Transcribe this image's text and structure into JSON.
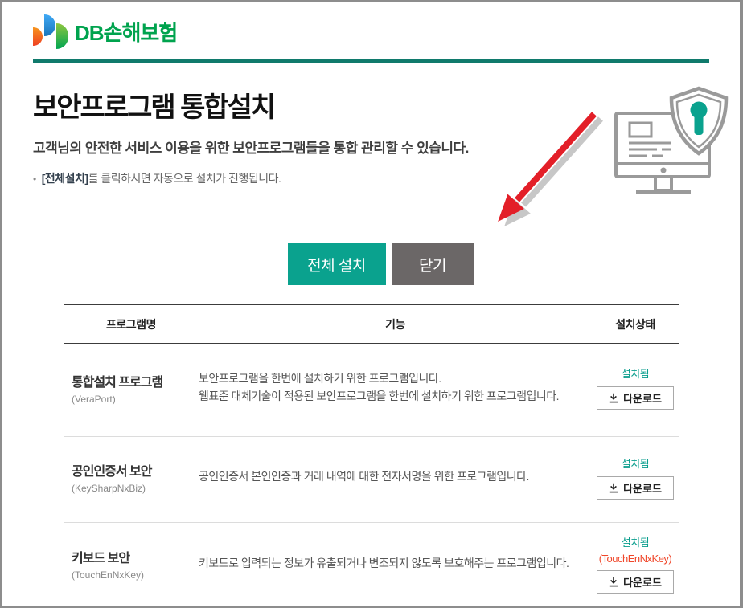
{
  "header": {
    "logo_text": "DB손해보험"
  },
  "page": {
    "title": "보안프로그램 통합설치",
    "subtitle": "고객님의 안전한 서비스 이용을 위한 보안프로그램들을 통합 관리할 수 있습니다.",
    "note_highlight": "[전체설치]",
    "note_rest": "를 클릭하시면 자동으로 설치가 진행됩니다."
  },
  "buttons": {
    "install_all": "전체 설치",
    "close": "닫기"
  },
  "table": {
    "headers": {
      "name": "프로그램명",
      "func": "기능",
      "status": "설치상태"
    },
    "rows": [
      {
        "name": "통합설치 프로그램",
        "code": "(VeraPort)",
        "desc1": "보안프로그램을 한번에 설치하기 위한 프로그램입니다.",
        "desc2": "웹표준 대체기술이 적용된 보안프로그램을 한번에 설치하기 위한 프로그램입니다.",
        "status": "설치됨",
        "download_label": "다운로드"
      },
      {
        "name": "공인인증서 보안",
        "code": "(KeySharpNxBiz)",
        "desc1": "공인인증서 본인인증과 거래 내역에 대한 전자서명을 위한 프로그램입니다.",
        "status": "설치됨",
        "download_label": "다운로드"
      },
      {
        "name": "키보드 보안",
        "code": "(TouchEnNxKey)",
        "desc1": "키보드로 입력되는 정보가 유출되거나 변조되지 않도록 보호해주는 프로그램입니다.",
        "status": "설치됨",
        "status_note": "(TouchEnNxKey)",
        "download_label": "다운로드"
      }
    ]
  },
  "icons": {
    "logo_mark": "db-tricolor-mark",
    "download": "download-icon",
    "pointer": "red-arrow-pointer",
    "illustration": "monitor-with-security-shield"
  },
  "colors": {
    "brand-green": "#00a34e",
    "divider-teal": "#107a6c",
    "accent-teal": "#0aa28e",
    "gray-button": "#6b6767",
    "status-teal": "#0a9e8d",
    "alert-red": "#f0472a",
    "arrow-red": "#e31f28"
  }
}
